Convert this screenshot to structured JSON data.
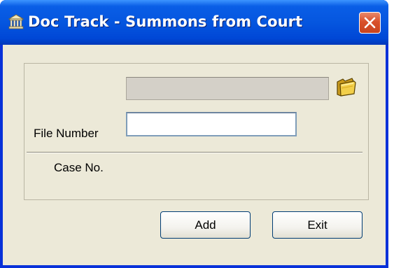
{
  "window": {
    "title": "Doc Track - Summons from Court",
    "app_icon": "building-icon",
    "close_icon": "close-icon"
  },
  "form": {
    "file_number_label": "File Number",
    "file_number_value": "",
    "browse_icon": "folder-icon",
    "case_no_label": "Case No.",
    "case_no_value": ""
  },
  "buttons": {
    "add_label": "Add",
    "exit_label": "Exit"
  },
  "colors": {
    "title_bar": "#0556df",
    "window_body": "#ece9d8",
    "close_button": "#d9502a",
    "disabled_field": "#d4d0c8"
  }
}
